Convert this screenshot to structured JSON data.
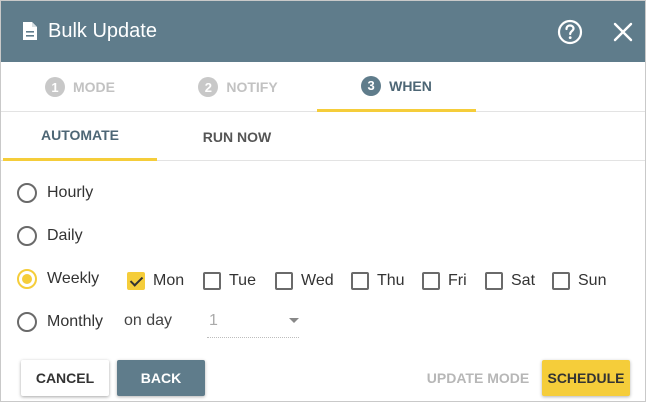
{
  "header": {
    "title": "Bulk Update",
    "doc_icon": "document-icon",
    "help_icon": "help-circle-icon",
    "close_icon": "close-icon",
    "color": "#5f7c8b"
  },
  "steps": [
    {
      "number": "1",
      "label": "MODE",
      "active": false
    },
    {
      "number": "2",
      "label": "NOTIFY",
      "active": false
    },
    {
      "number": "3",
      "label": "WHEN",
      "active": true
    }
  ],
  "subtabs": [
    {
      "label": "AUTOMATE",
      "active": true
    },
    {
      "label": "RUN NOW",
      "active": false
    }
  ],
  "frequency": {
    "options": [
      {
        "label": "Hourly",
        "checked": false
      },
      {
        "label": "Daily",
        "checked": false
      },
      {
        "label": "Weekly",
        "checked": true
      },
      {
        "label": "Monthly",
        "checked": false
      }
    ]
  },
  "weekdays": [
    {
      "label": "Mon",
      "checked": true
    },
    {
      "label": "Tue",
      "checked": false
    },
    {
      "label": "Wed",
      "checked": false
    },
    {
      "label": "Thu",
      "checked": false
    },
    {
      "label": "Fri",
      "checked": false
    },
    {
      "label": "Sat",
      "checked": false
    },
    {
      "label": "Sun",
      "checked": false
    }
  ],
  "monthly": {
    "on_day_label": "on day",
    "day_value": "1"
  },
  "buttons": {
    "cancel": "CANCEL",
    "back": "BACK",
    "update_mode": "UPDATE MODE",
    "schedule": "SCHEDULE"
  },
  "colors": {
    "accent": "#f5cd3a",
    "primary": "#5f7c8b"
  }
}
